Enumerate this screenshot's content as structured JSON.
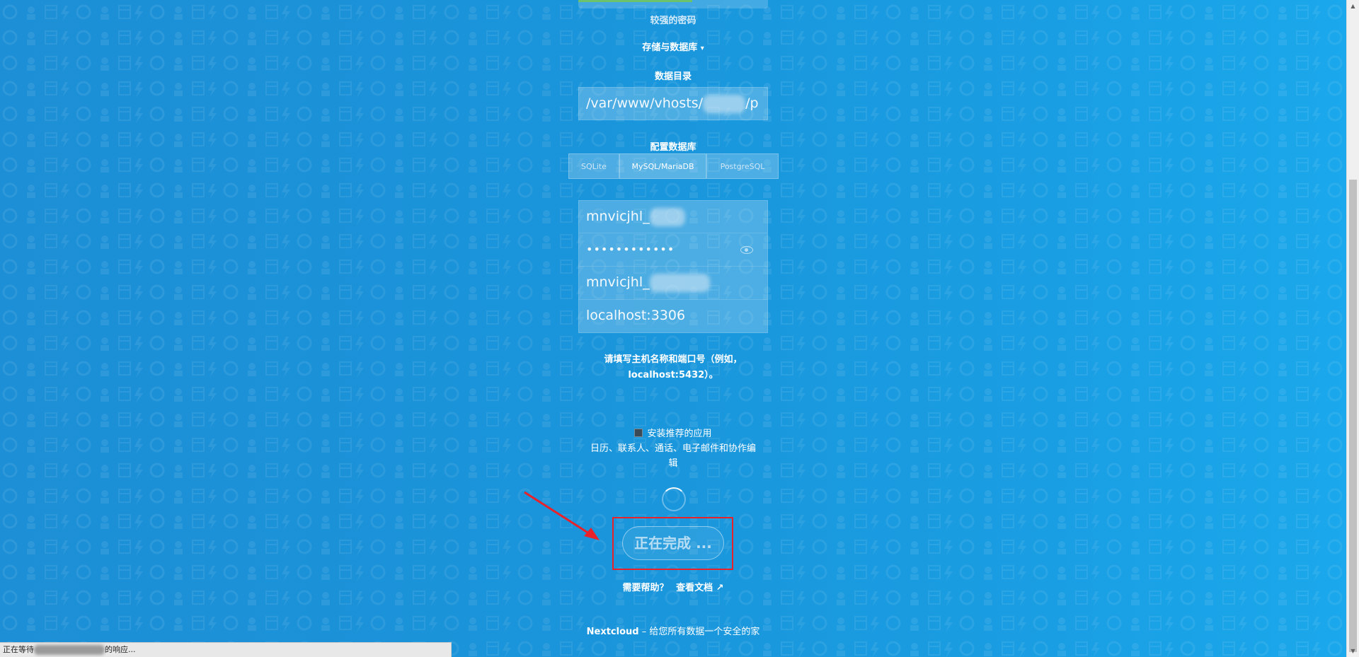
{
  "password_strength": {
    "label": "较强的密码",
    "fill_fraction": 0.6,
    "color": "#6cc16c"
  },
  "storage_toggle": {
    "label": "存储与数据库",
    "caret": "▾"
  },
  "data_dir": {
    "label": "数据目录",
    "value_prefix": "/var/www/vhosts/",
    "value_suffix": "/p"
  },
  "db_config": {
    "label": "配置数据库",
    "options": [
      {
        "label": "SQLite",
        "active": false
      },
      {
        "label": "MySQL/MariaDB",
        "active": true
      },
      {
        "label": "PostgreSQL",
        "active": false
      }
    ]
  },
  "credentials": {
    "db_user_prefix": "mnvicjhl_",
    "db_password_mask": "••••••••••••",
    "db_name_prefix": "mnvicjhl_",
    "db_host": "localhost:3306"
  },
  "host_hint": {
    "line1": "请填写主机名称和端口号（例如，",
    "line2": "localhost:5432）。"
  },
  "recommended_apps": {
    "label": "安装推荐的应用",
    "description_line1": "日历、联系人、通话、电子邮件和协作编",
    "description_line2": "辑",
    "checked": false
  },
  "finish_button": {
    "label": "正在完成 ..."
  },
  "help": {
    "question": "需要帮助？",
    "link": "查看文档 ↗"
  },
  "footer": {
    "brand": "Nextcloud",
    "tagline": "– 给您所有数据一个安全的家"
  },
  "status_bar": {
    "prefix": "正在等待",
    "suffix": "的响应..."
  },
  "colors": {
    "background": "#1a94da",
    "annotation_red": "#e8222a"
  }
}
